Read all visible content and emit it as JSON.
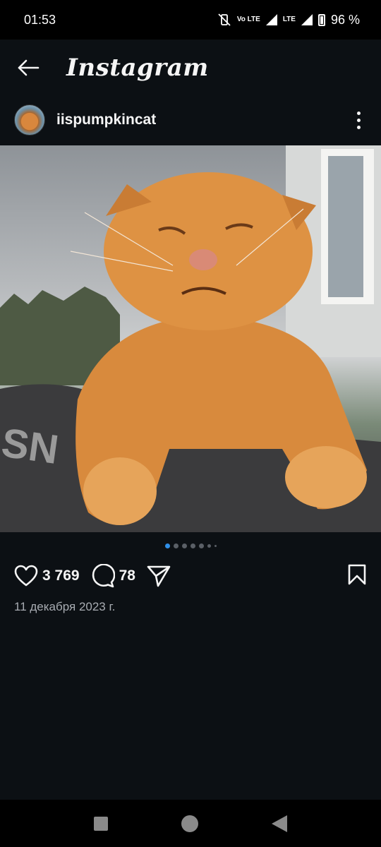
{
  "status_bar": {
    "time": "01:53",
    "network_1": "Vo LTE",
    "network_2": "LTE",
    "battery": "96 %"
  },
  "topbar": {
    "title": "Instagram",
    "back_icon": "arrow-left-icon"
  },
  "post": {
    "username": "iispumpkincat",
    "image_alt": "orange scottish fold cat",
    "carousel": {
      "total_visible_dots": 7,
      "active_index": 0
    },
    "likes": "3 769",
    "comments": "78",
    "date": "11 декабря 2023 г."
  },
  "icons": {
    "like": "heart-icon",
    "comment": "comment-icon",
    "share": "send-icon",
    "save": "bookmark-icon",
    "more": "more-vertical-icon"
  },
  "colors": {
    "background": "#0c1014",
    "accent_dot": "#2f8fe8",
    "text_secondary": "#a8acb2"
  }
}
